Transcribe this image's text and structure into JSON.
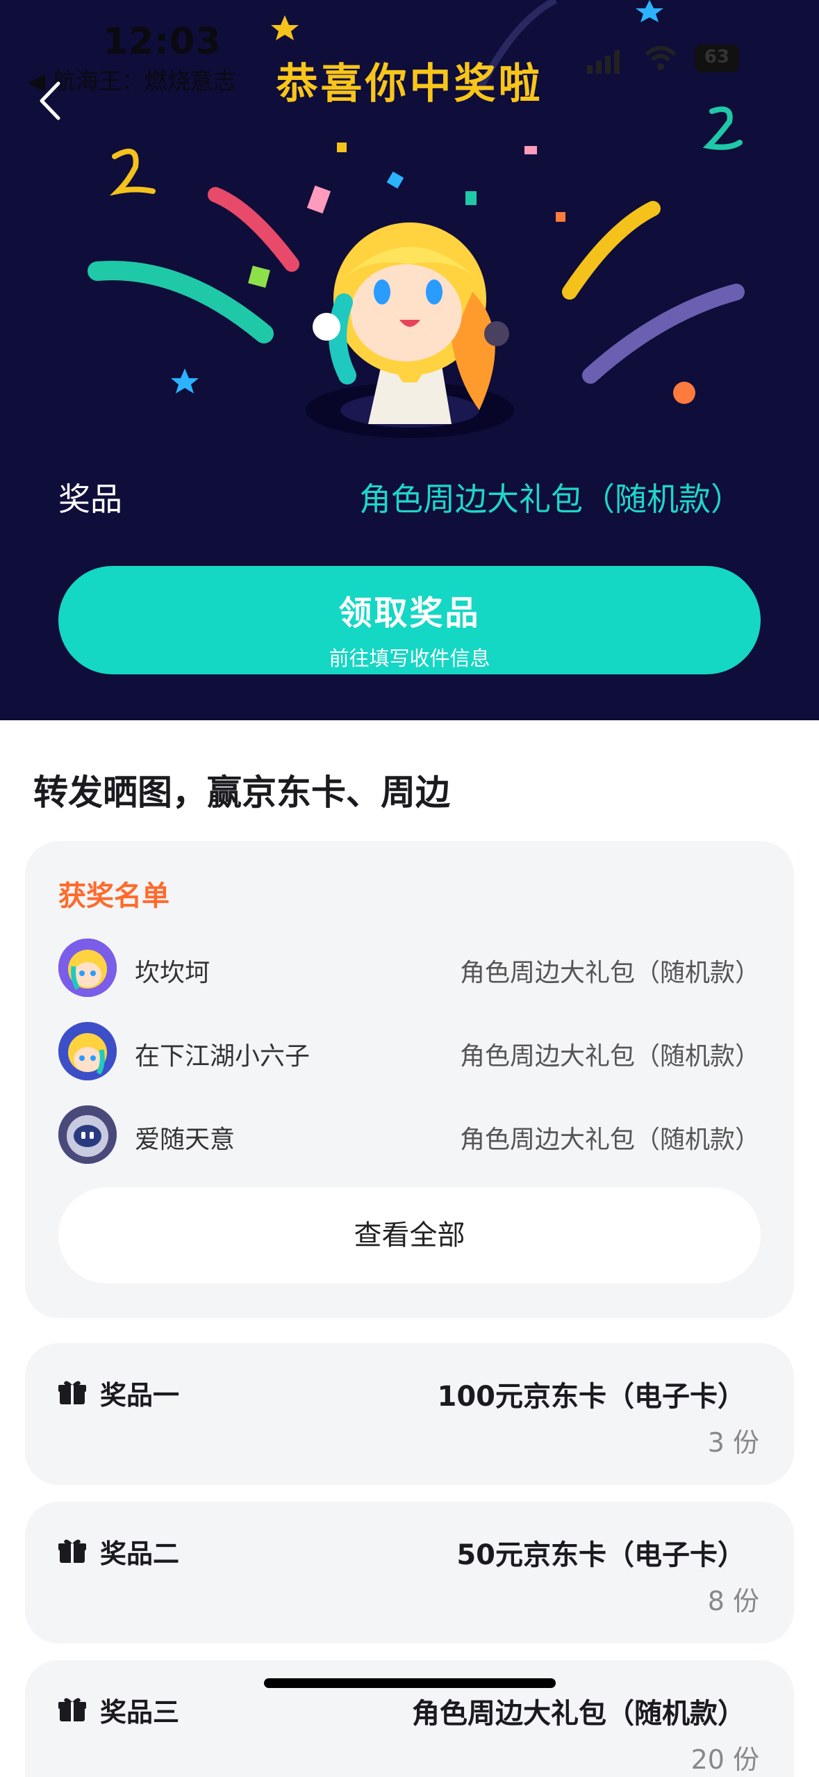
{
  "status_bar": {
    "time": "12:03",
    "back_app": "◀ 航海王：燃烧意志",
    "battery": "63"
  },
  "header": {
    "title": "恭喜你中奖啦"
  },
  "prize": {
    "label": "奖品",
    "name": "角色周边大礼包（随机款）"
  },
  "claim_button": {
    "title": "领取奖品",
    "subtitle": "前往填写收件信息"
  },
  "section": {
    "title": "转发晒图，赢京东卡、周边"
  },
  "winners": {
    "heading": "获奖名单",
    "items": [
      {
        "name": "坎坎坷",
        "prize": "角色周边大礼包（随机款）"
      },
      {
        "name": "在下江湖小六子",
        "prize": "角色周边大礼包（随机款）"
      },
      {
        "name": "爱随天意",
        "prize": "角色周边大礼包（随机款）"
      }
    ],
    "view_all": "查看全部"
  },
  "tiers": [
    {
      "label": "奖品一",
      "prize": "100元京东卡（电子卡）",
      "count": "3 份"
    },
    {
      "label": "奖品二",
      "prize": "50元京东卡（电子卡）",
      "count": "8 份"
    },
    {
      "label": "奖品三",
      "prize": "角色周边大礼包（随机款）",
      "count": "20 份"
    }
  ],
  "colors": {
    "hero_bg": "#0f0d3a",
    "title_gold": "#f8c51a",
    "accent_teal": "#14d7c4",
    "winners_orange": "#ff6a2b",
    "card_bg": "#f4f5f7"
  },
  "icons": [
    "back-chevron-icon",
    "gift-icon",
    "signal-icon",
    "wifi-icon",
    "battery-icon"
  ]
}
